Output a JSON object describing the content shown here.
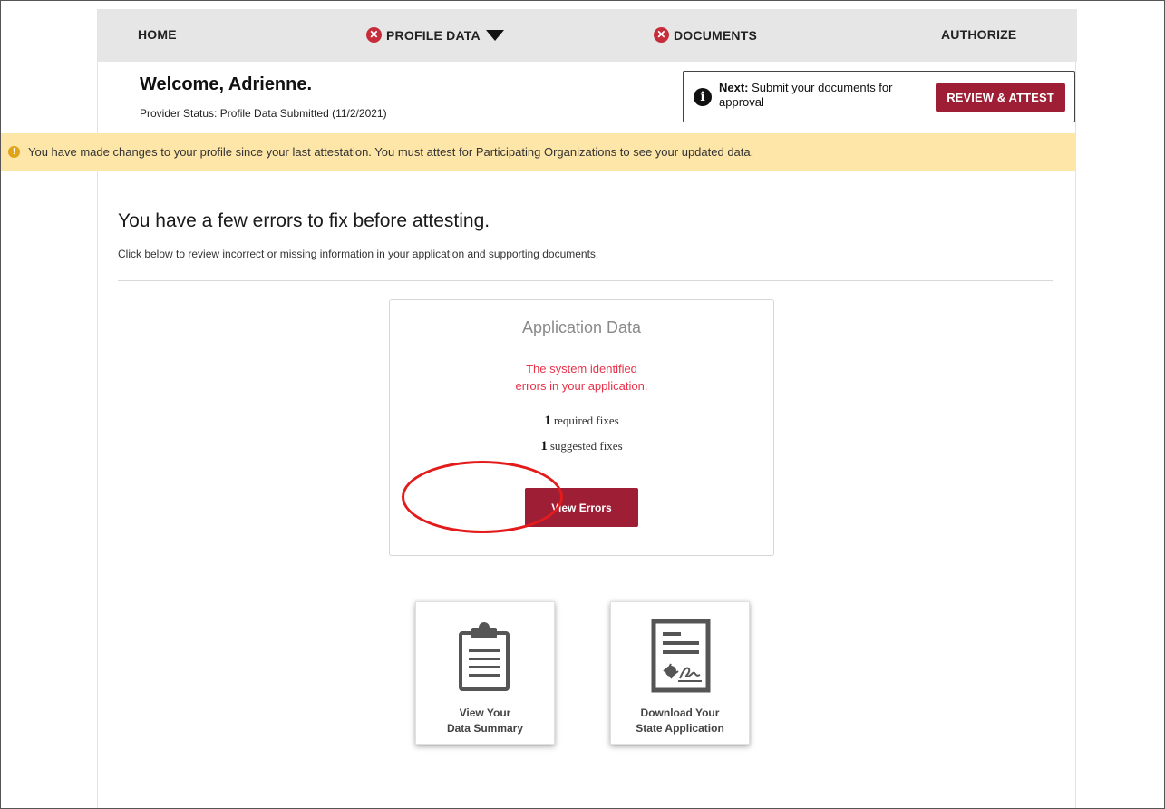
{
  "nav": {
    "home": "HOME",
    "profile_data": "PROFILE DATA",
    "documents": "DOCUMENTS",
    "authorize": "AUTHORIZE",
    "error_glyph": "✕"
  },
  "header": {
    "welcome": "Welcome, Adrienne.",
    "provider_status": "Provider Status:  Profile Data Submitted (11/2/2021)",
    "next_label": "Next:",
    "next_text": " Submit your documents for approval",
    "info_glyph": "i",
    "review_button": "REVIEW & ATTEST"
  },
  "banner": {
    "text": "You have made changes to your profile since your last attestation. You must attest for Participating Organizations to see your updated data.",
    "icon_glyph": "!"
  },
  "main": {
    "title": "You have a few errors to fix before attesting.",
    "subtitle": "Click below to review incorrect or missing information in your application and supporting documents."
  },
  "card": {
    "title": "Application Data",
    "error_line1": "The system identified",
    "error_line2": "errors in your application.",
    "required_count": "1",
    "required_label": "required fixes",
    "suggested_count": "1",
    "suggested_label": "suggested fixes",
    "view_errors_button": "View Errors"
  },
  "tiles": {
    "summary_line1": "View Your",
    "summary_line2": "Data Summary",
    "download_line1": "Download Your",
    "download_line2": "State Application"
  },
  "icons": {
    "nav_error": "x-circle-icon",
    "info": "info-circle-icon",
    "warning": "exclamation-circle-icon",
    "summary": "clipboard-icon",
    "download": "signed-document-icon"
  },
  "colors": {
    "brand": "#9e1e36",
    "error_text": "#e8334a",
    "nav_bg": "#e6e6e6",
    "banner_bg": "#fde6a8",
    "highlight_ring": "#e31b1b"
  }
}
